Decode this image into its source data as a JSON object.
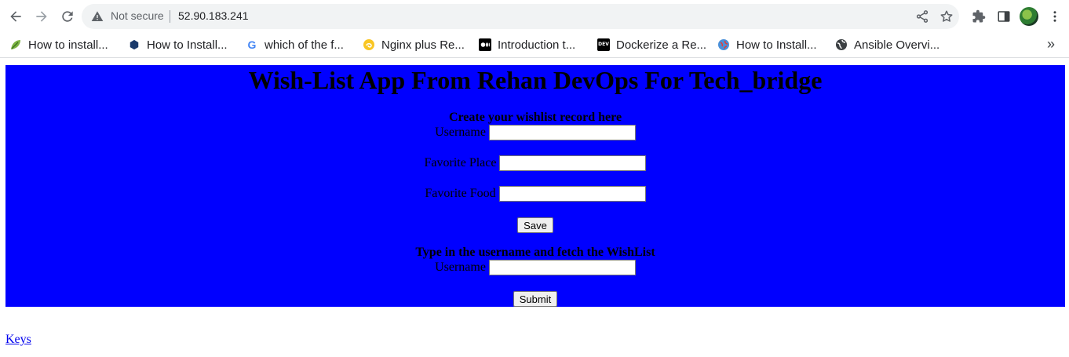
{
  "browser": {
    "security_status": "Not secure",
    "url": "52.90.183.241",
    "bookmarks": [
      {
        "label": "How to install...",
        "icon": "leaf-icon"
      },
      {
        "label": "How to Install...",
        "icon": "hexagon-icon"
      },
      {
        "label": "which of the f...",
        "icon": "google-icon"
      },
      {
        "label": "Nginx plus Re...",
        "icon": "swirl-icon"
      },
      {
        "label": "Introduction t...",
        "icon": "medium-icon"
      },
      {
        "label": "Dockerize a Re...",
        "icon": "dev-icon"
      },
      {
        "label": "How to Install...",
        "icon": "globe-icon"
      },
      {
        "label": "Ansible Overvi...",
        "icon": "world-icon"
      }
    ],
    "more_bookmarks": "»"
  },
  "page": {
    "title": "Wish-List App From Rehan DevOps For Tech_bridge",
    "panel_color": "#0000ff",
    "create_section": {
      "heading": "Create your wishlist record here",
      "username_label": "Username",
      "place_label": "Favorite Place",
      "food_label": "Favorite Food",
      "save_label": "Save"
    },
    "fetch_section": {
      "heading": "Type in the username and fetch the WishList",
      "username_label": "Username",
      "submit_label": "Submit"
    },
    "keys_link": "Keys"
  }
}
